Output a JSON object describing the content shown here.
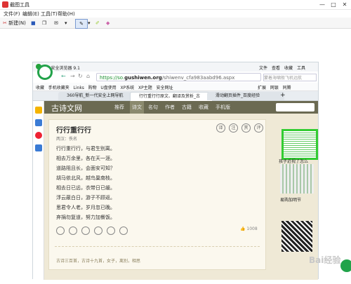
{
  "window": {
    "title": "截图工具",
    "min": "—",
    "max": "□",
    "close": "✕"
  },
  "menu": [
    "文件(F)",
    "编辑(E)",
    "工具(T)",
    "帮助(H)"
  ],
  "toolbar": {
    "new_label": "新建(N)"
  },
  "browser": {
    "title": "360安全浏览器 9.1",
    "title_menu": [
      "文件",
      "查看",
      "收藏",
      "工具"
    ],
    "url_prefix": "https://so.",
    "url_domain": "gushiwen.org",
    "url_path": "/shiwenv_cfa983aabd96.aspx",
    "search_placeholder": "蒙着海啸般飞机远航",
    "favorites": [
      "收藏",
      "手机收藏夹",
      "Links",
      "购物",
      "U盘使用",
      "XP系统",
      "XP主题",
      "安全网址"
    ],
    "fav_right": [
      "扩展",
      "网银",
      "同腾"
    ],
    "tabs": [
      "360导航_新一代安全上网导航",
      "行行重行行原文、翻译及赏析_古",
      "滑动翻页插件_百度经验"
    ],
    "tab_add": "+"
  },
  "site": {
    "logo": "古诗文网",
    "nav": [
      "推荐",
      "诗文",
      "名句",
      "作者",
      "古籍",
      "收藏",
      "手机版"
    ],
    "poem_title": "行行重行行",
    "poem_meta": "两汉：佚名",
    "lines": [
      "行行重行行，与君生别离。",
      "相去万余里，各在天一涯。",
      "道路阻且长，会面安可知？",
      "胡马依北风，越鸟巢南枝。",
      "相去日已远，衣带日已缓。",
      "浮云蔽白日，游子不顾返。",
      "思君令人老，岁月忽已晚。",
      "弃捐勿复道，努力加餐饭。"
    ],
    "buttons": [
      "译",
      "注",
      "赏",
      "评"
    ],
    "likes": "1008",
    "tags": "古诗三百首，古诗十九首，女子，离别，相思",
    "right_caption": "孩子近视了怎么",
    "right_caption2": "易购加明节"
  },
  "watermark": "Bai经验",
  "colors": {
    "nav_bg": "#6b6a52",
    "page_bg": "#efe9d6",
    "url_green": "#1a8f2e"
  }
}
